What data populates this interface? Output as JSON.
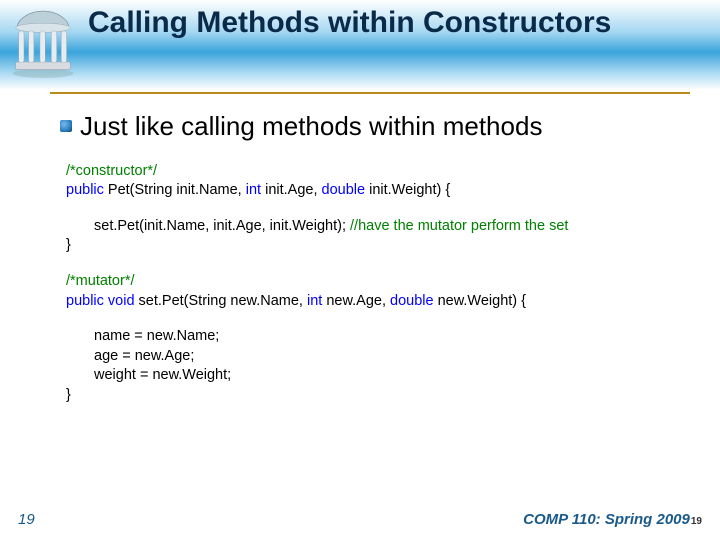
{
  "title": "Calling Methods within Constructors",
  "bullet": "Just like calling methods within methods",
  "code": {
    "c1_comment": "/*constructor*/",
    "c1_sig_pre": "public ",
    "c1_sig_name": "Pet(String init.Name, ",
    "c1_sig_int": "int",
    "c1_sig_mid": " init.Age, ",
    "c1_sig_double": "double",
    "c1_sig_post": " init.Weight)  {",
    "c1_body": "set.Pet(init.Name, init.Age, init.Weight); ",
    "c1_body_comment": "//have the mutator perform the set",
    "close1": "}",
    "c2_comment": "/*mutator*/",
    "c2_sig_pre": "public void ",
    "c2_sig_name": "set.Pet(String new.Name, ",
    "c2_sig_int": "int",
    "c2_sig_mid": " new.Age, ",
    "c2_sig_double": "double",
    "c2_sig_post": " new.Weight)  {",
    "c2_b1": "name = new.Name;",
    "c2_b2": "age = new.Age;",
    "c2_b3": "weight = new.Weight;",
    "close2": "}"
  },
  "footer": {
    "left": "19",
    "right": "COMP 110: Spring 2009",
    "page_small": "19"
  },
  "colors": {
    "accent": "#1a5a8a",
    "underline": "#b88a1a",
    "comment": "#008000",
    "keyword": "#0000ff"
  }
}
